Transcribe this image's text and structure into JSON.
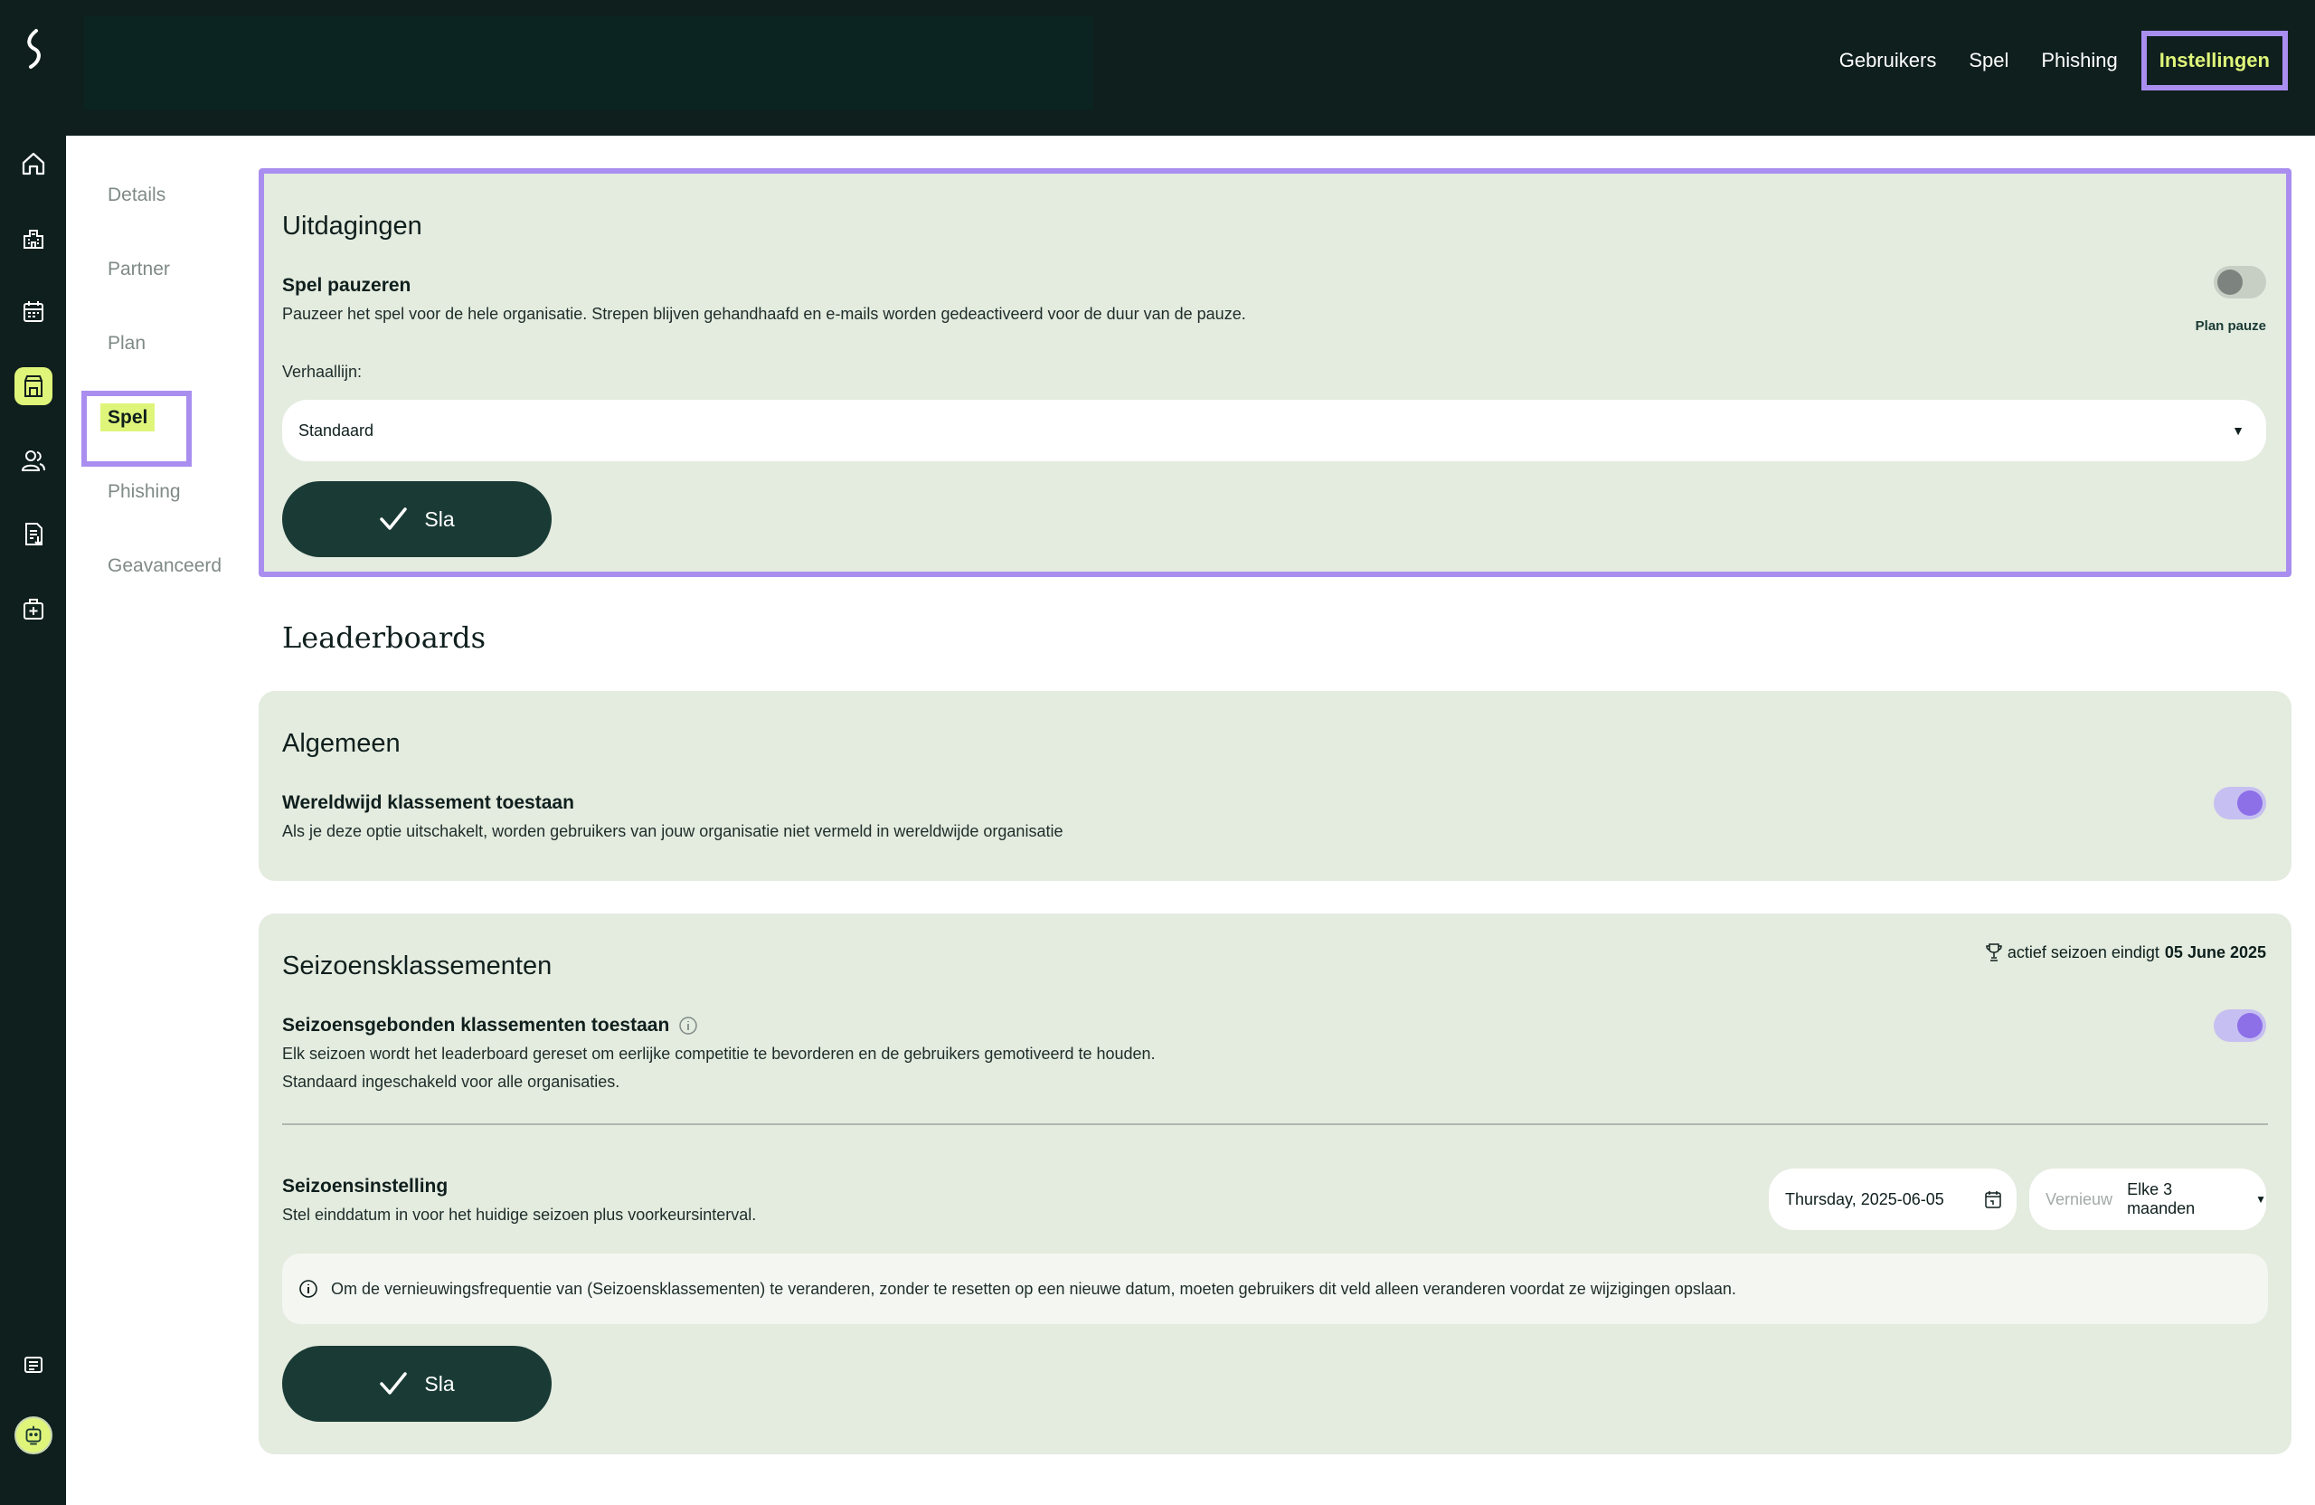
{
  "topnav": {
    "items": [
      "Gebruikers",
      "Spel",
      "Phishing"
    ],
    "active": "Instellingen"
  },
  "subnav": {
    "items": [
      "Details",
      "Partner",
      "Plan",
      "Spel",
      "Phishing",
      "Geavanceerd"
    ],
    "active_index": 3
  },
  "challenges": {
    "title": "Uitdagingen",
    "pause_title": "Spel pauzeren",
    "pause_desc": "Pauzeer het spel voor de hele organisatie. Strepen blijven gehandhaafd en e-mails worden gedeactiveerd voor de duur van de pauze.",
    "plan_pause": "Plan pauze",
    "storyline_label": "Verhaallijn:",
    "storyline_value": "Standaard",
    "save_label": "Sla"
  },
  "leaderboards": {
    "heading": "Leaderboards",
    "general_title": "Algemeen",
    "global_title": "Wereldwijd klassement toestaan",
    "global_desc": "Als je deze optie uitschakelt, worden gebruikers van jouw organisatie niet vermeld in wereldwijde organisatie"
  },
  "seasons": {
    "title": "Seizoensklassementen",
    "active_prefix": "actief seizoen eindigt",
    "active_date": "05 June 2025",
    "allow_title": "Seizoensgebonden klassementen toestaan",
    "allow_desc_1": "Elk seizoen wordt het leaderboard gereset om eerlijke competitie te bevorderen en de gebruikers gemotiveerd te houden.",
    "allow_desc_2": "Standaard ingeschakeld voor alle organisaties.",
    "setting_title": "Seizoensinstelling",
    "setting_desc": "Stel einddatum in voor het huidige seizoen plus voorkeursinterval.",
    "date_value": "Thursday, 2025-06-05",
    "renew_placeholder": "Vernieuw",
    "renew_value": "Elke 3 maanden",
    "info_text": "Om de vernieuwingsfrequentie van (Seizoensklassementen) te veranderen, zonder te resetten op een nieuwe datum, moeten gebruikers dit veld alleen veranderen voordat ze wijzigingen opslaan.",
    "save_label": "Sla"
  },
  "toggles": {
    "pause": false,
    "global": true,
    "seasonal": true
  },
  "colors": {
    "accent": "#dff57a",
    "highlight": "#a98ef0",
    "dark": "#0f1f1d",
    "card": "#e4ebdf",
    "button": "#1a3b35"
  }
}
